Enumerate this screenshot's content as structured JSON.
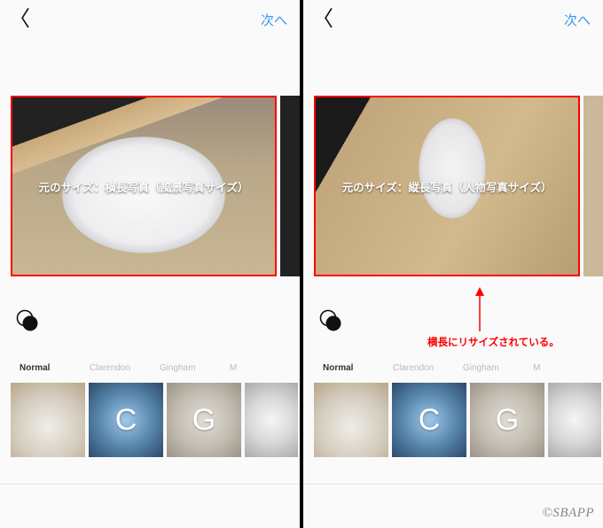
{
  "left": {
    "nav": {
      "next_label": "次へ"
    },
    "overlay": "元のサイズ：横長写真（風景写真サイズ）",
    "filters": [
      {
        "name": "Normal",
        "letter": "",
        "selected": true
      },
      {
        "name": "Clarendon",
        "letter": "C",
        "selected": false
      },
      {
        "name": "Gingham",
        "letter": "G",
        "selected": false
      },
      {
        "name": "M",
        "letter": "",
        "selected": false
      }
    ]
  },
  "right": {
    "nav": {
      "next_label": "次へ"
    },
    "overlay": "元のサイズ：縦長写真（人物写真サイズ）",
    "resize_note": "横長にリサイズされている。",
    "filters": [
      {
        "name": "Normal",
        "letter": "",
        "selected": true
      },
      {
        "name": "Clarendon",
        "letter": "C",
        "selected": false
      },
      {
        "name": "Gingham",
        "letter": "G",
        "selected": false
      },
      {
        "name": "M",
        "letter": "",
        "selected": false
      }
    ]
  },
  "watermark": "©SBAPP"
}
